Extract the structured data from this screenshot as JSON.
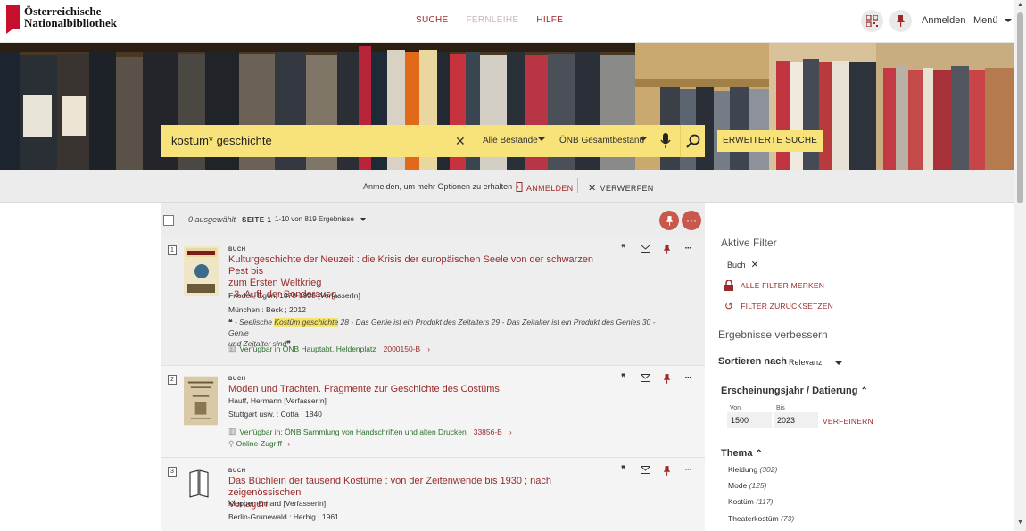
{
  "header": {
    "logo_line1": "Österreichische",
    "logo_line2": "Nationalbibliothek",
    "nav": [
      "SUCHE",
      "FERNLEIHE",
      "HILFE"
    ],
    "login_label": "Anmelden",
    "menu_label": "Menü"
  },
  "search": {
    "query": "kostüm* geschichte",
    "scope": "Alle Bestände",
    "collection": "ÖNB Gesamtbestand",
    "advanced_label": "ERWEITERTE SUCHE"
  },
  "loginbar": {
    "message": "Anmelden, um mehr Optionen zu erhalten",
    "login_action": "ANMELDEN",
    "dismiss_action": "VERWERFEN"
  },
  "results_header": {
    "selected": "0 ausgewählt",
    "page": "SEITE 1",
    "range": "1-10 von 819 Ergebnisse"
  },
  "results": [
    {
      "num": "1",
      "kind": "BUCH",
      "title_line1": "Kulturgeschichte der Neuzeit : die Krisis der europäischen Seele von der schwarzen Pest bis",
      "title_line2": "zum Ersten Weltkrieg",
      "title_line3": ". 3. Aufl. der Sonderausg.",
      "author": "Friedell, Egon, 1878-1938 [VerfasserIn]",
      "publisher": "München : Beck ; 2012",
      "quote_pre": " - Seelische ",
      "quote_hl": "Kostüm geschichte",
      "quote_post": " 28 - Das Genie ist ein Produkt des Zeitalters 29 - Das Zeitalter ist ein Produkt des Genies 30 - Genie",
      "quote_line2": "und Zeitalter sind",
      "availability": "Verfügbar in ÖNB Hauptabt. Heldenplatz",
      "signature": "2000150-B"
    },
    {
      "num": "2",
      "kind": "BUCH",
      "title_line1": "Moden und Trachten. Fragmente zur Geschichte des Costüms",
      "author": "Hauff, Hermann [VerfasserIn]",
      "publisher": "Stuttgart usw. : Cotta ; 1840",
      "availability": "Verfügbar in: ÖNB Sammlung von Handschriften und alten Drucken",
      "signature": "33856-B",
      "online": "Online-Zugriff"
    },
    {
      "num": "3",
      "kind": "BUCH",
      "title_line1": "Das Büchlein der tausend Kostüme : von der Zeitenwende bis 1930 ; nach zeigenössischen",
      "title_line2": "Vorlagen",
      "author": "Klepper, Erhard [VerfasserIn]",
      "publisher": "Berlin-Grunewald : Herbig ; 1961"
    }
  ],
  "sidebar": {
    "active_filters": "Aktive Filter",
    "filter_chip": "Buch",
    "save_filters": "ALLE FILTER MERKEN",
    "reset_filters": "FILTER ZURÜCKSETZEN",
    "refine_title": "Ergebnisse verbessern",
    "sort_label": "Sortieren nach",
    "sort_value": "Relevanz",
    "year_title": "Erscheinungsjahr / Datierung",
    "from_label": "Von",
    "to_label": "Bis",
    "from_value": "1500",
    "to_value": "2023",
    "refine_btn": "VERFEINERN",
    "topic_title": "Thema",
    "topics": [
      {
        "name": "Kleidung",
        "count": "(302)"
      },
      {
        "name": "Mode",
        "count": "(125)"
      },
      {
        "name": "Kostüm",
        "count": "(117)"
      },
      {
        "name": "Theaterkostüm",
        "count": "(73)"
      }
    ]
  },
  "colors": {
    "accent": "#9a2a2a",
    "search_bg": "#f7e37a",
    "available": "#2b6e2b"
  }
}
